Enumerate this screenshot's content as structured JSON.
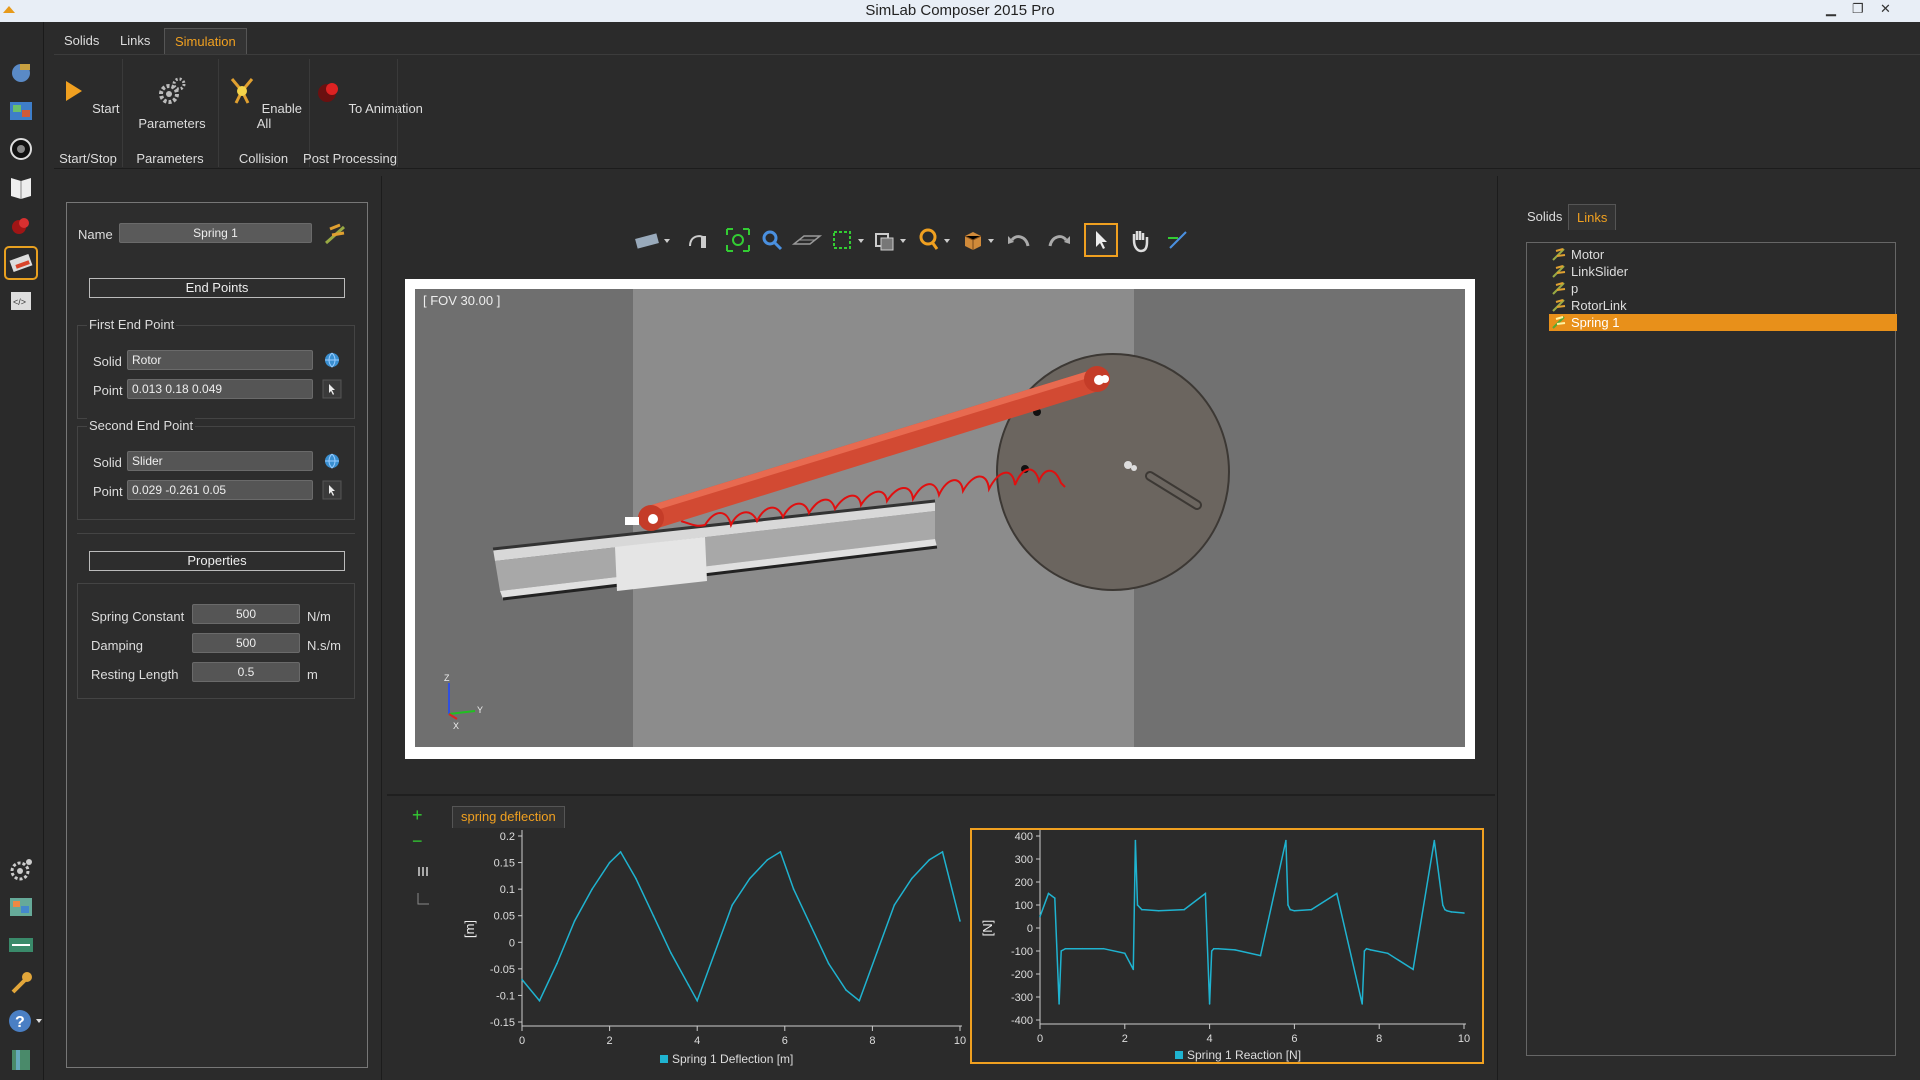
{
  "app": {
    "title": "SimLab Composer 2015 Pro"
  },
  "ribbon": {
    "tabs": [
      {
        "label": "Solids"
      },
      {
        "label": "Links"
      },
      {
        "label": "Simulation"
      }
    ],
    "buttons": [
      {
        "label": "Start",
        "icon": "play-icon"
      },
      {
        "label": "Parameters",
        "icon": "gears-icon"
      },
      {
        "label": "Enable All",
        "icon": "collision-icon"
      },
      {
        "label": "To Animation",
        "icon": "record-icon"
      }
    ],
    "groups": [
      {
        "label": "Start/Stop"
      },
      {
        "label": "Parameters"
      },
      {
        "label": "Collision"
      },
      {
        "label": "Post Processing"
      }
    ]
  },
  "properties_panel": {
    "name_label": "Name",
    "name_value": "Spring 1",
    "end_points_header": "End Points",
    "first_end_point": {
      "title": "First End Point",
      "solid_label": "Solid",
      "solid_value": "Rotor",
      "point_label": "Point",
      "point_value": "0.013 0.18 0.049"
    },
    "second_end_point": {
      "title": "Second End Point",
      "solid_label": "Solid",
      "solid_value": "Slider",
      "point_label": "Point",
      "point_value": "0.029 -0.261 0.05"
    },
    "properties_header": "Properties",
    "spring_constant": {
      "label": "Spring Constant",
      "value": "500",
      "unit": "N/m"
    },
    "damping": {
      "label": "Damping",
      "value": "500",
      "unit": "N.s/m"
    },
    "resting_length": {
      "label": "Resting Length",
      "value": "0.5",
      "unit": "m"
    }
  },
  "viewport": {
    "fov_label": "[ FOV 30.00 ]",
    "axis_labels": {
      "z": "Z",
      "y": "Y",
      "x": "X"
    }
  },
  "right_panel": {
    "tabs": [
      {
        "label": "Solids"
      },
      {
        "label": "Links"
      }
    ],
    "active_tab": "Links",
    "tree_items": [
      {
        "label": "Motor"
      },
      {
        "label": "LinkSlider"
      },
      {
        "label": "p"
      },
      {
        "label": "RotorLink"
      },
      {
        "label": "Spring 1"
      }
    ],
    "selected_item": "Spring 1"
  },
  "chart_panel": {
    "tab_label": "spring deflection"
  },
  "chart_data": [
    {
      "type": "line",
      "ylabel": "[m]",
      "xlim": [
        0,
        10
      ],
      "ylim": [
        -0.15,
        0.2
      ],
      "xticks": [
        "0",
        "2",
        "4",
        "6",
        "8",
        "10"
      ],
      "yticks": [
        "0.2",
        "0.15",
        "0.1",
        "0.05",
        "0",
        "-0.05",
        "-0.1",
        "-0.15"
      ],
      "series": [
        {
          "name": "Spring 1 Deflection [m]",
          "color": "#1fb3d0",
          "x": [
            0,
            0.4,
            0.8,
            1.2,
            1.6,
            2.0,
            2.25,
            2.6,
            3.0,
            3.4,
            3.8,
            4.0,
            4.4,
            4.8,
            5.2,
            5.6,
            5.9,
            6.2,
            6.6,
            7.0,
            7.4,
            7.7,
            8.1,
            8.5,
            8.9,
            9.3,
            9.6,
            10.0
          ],
          "values": [
            -0.07,
            -0.11,
            -0.04,
            0.04,
            0.1,
            0.15,
            0.17,
            0.12,
            0.05,
            -0.02,
            -0.08,
            -0.11,
            -0.02,
            0.07,
            0.12,
            0.155,
            0.17,
            0.1,
            0.03,
            -0.04,
            -0.09,
            -0.11,
            -0.02,
            0.07,
            0.12,
            0.155,
            0.17,
            0.04
          ]
        }
      ]
    },
    {
      "type": "line",
      "ylabel": "[N]",
      "xlim": [
        0,
        10
      ],
      "ylim": [
        -400,
        400
      ],
      "xticks": [
        "0",
        "2",
        "4",
        "6",
        "8",
        "10"
      ],
      "yticks": [
        "400",
        "300",
        "200",
        "100",
        "0",
        "-100",
        "-200",
        "-300",
        "-400"
      ],
      "series": [
        {
          "name": "Spring 1 Reaction [N]",
          "color": "#1fb3d0",
          "x": [
            0,
            0.2,
            0.35,
            0.45,
            0.5,
            0.6,
            1.0,
            1.5,
            2.0,
            2.2,
            2.25,
            2.3,
            2.4,
            2.8,
            3.4,
            3.9,
            4.0,
            4.05,
            4.1,
            4.2,
            4.6,
            5.2,
            5.8,
            5.85,
            5.9,
            6.0,
            6.4,
            7.0,
            7.6,
            7.65,
            7.7,
            7.8,
            8.2,
            8.8,
            9.3,
            9.5,
            9.55,
            9.6,
            9.7,
            10.0
          ],
          "values": [
            50,
            150,
            130,
            -330,
            -100,
            -90,
            -90,
            -90,
            -110,
            -180,
            380,
            100,
            80,
            75,
            80,
            150,
            -330,
            -100,
            -90,
            -90,
            -95,
            -120,
            380,
            100,
            80,
            75,
            80,
            150,
            -330,
            -100,
            -90,
            -95,
            -110,
            -180,
            380,
            100,
            80,
            75,
            70,
            65
          ]
        }
      ]
    }
  ]
}
